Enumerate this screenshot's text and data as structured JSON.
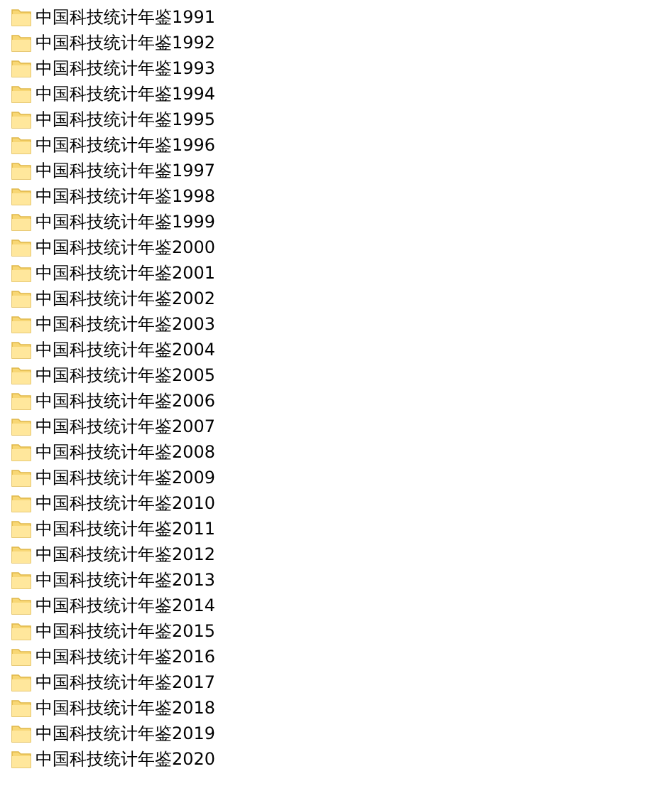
{
  "folders": [
    {
      "name": "中国科技统计年鉴1991"
    },
    {
      "name": "中国科技统计年鉴1992"
    },
    {
      "name": "中国科技统计年鉴1993"
    },
    {
      "name": "中国科技统计年鉴1994"
    },
    {
      "name": "中国科技统计年鉴1995"
    },
    {
      "name": "中国科技统计年鉴1996"
    },
    {
      "name": "中国科技统计年鉴1997"
    },
    {
      "name": "中国科技统计年鉴1998"
    },
    {
      "name": "中国科技统计年鉴1999"
    },
    {
      "name": "中国科技统计年鉴2000"
    },
    {
      "name": "中国科技统计年鉴2001"
    },
    {
      "name": "中国科技统计年鉴2002"
    },
    {
      "name": "中国科技统计年鉴2003"
    },
    {
      "name": "中国科技统计年鉴2004"
    },
    {
      "name": "中国科技统计年鉴2005"
    },
    {
      "name": "中国科技统计年鉴2006"
    },
    {
      "name": "中国科技统计年鉴2007"
    },
    {
      "name": "中国科技统计年鉴2008"
    },
    {
      "name": "中国科技统计年鉴2009"
    },
    {
      "name": "中国科技统计年鉴2010"
    },
    {
      "name": "中国科技统计年鉴2011"
    },
    {
      "name": "中国科技统计年鉴2012"
    },
    {
      "name": "中国科技统计年鉴2013"
    },
    {
      "name": "中国科技统计年鉴2014"
    },
    {
      "name": "中国科技统计年鉴2015"
    },
    {
      "name": "中国科技统计年鉴2016"
    },
    {
      "name": "中国科技统计年鉴2017"
    },
    {
      "name": "中国科技统计年鉴2018"
    },
    {
      "name": "中国科技统计年鉴2019"
    },
    {
      "name": "中国科技统计年鉴2020"
    }
  ]
}
